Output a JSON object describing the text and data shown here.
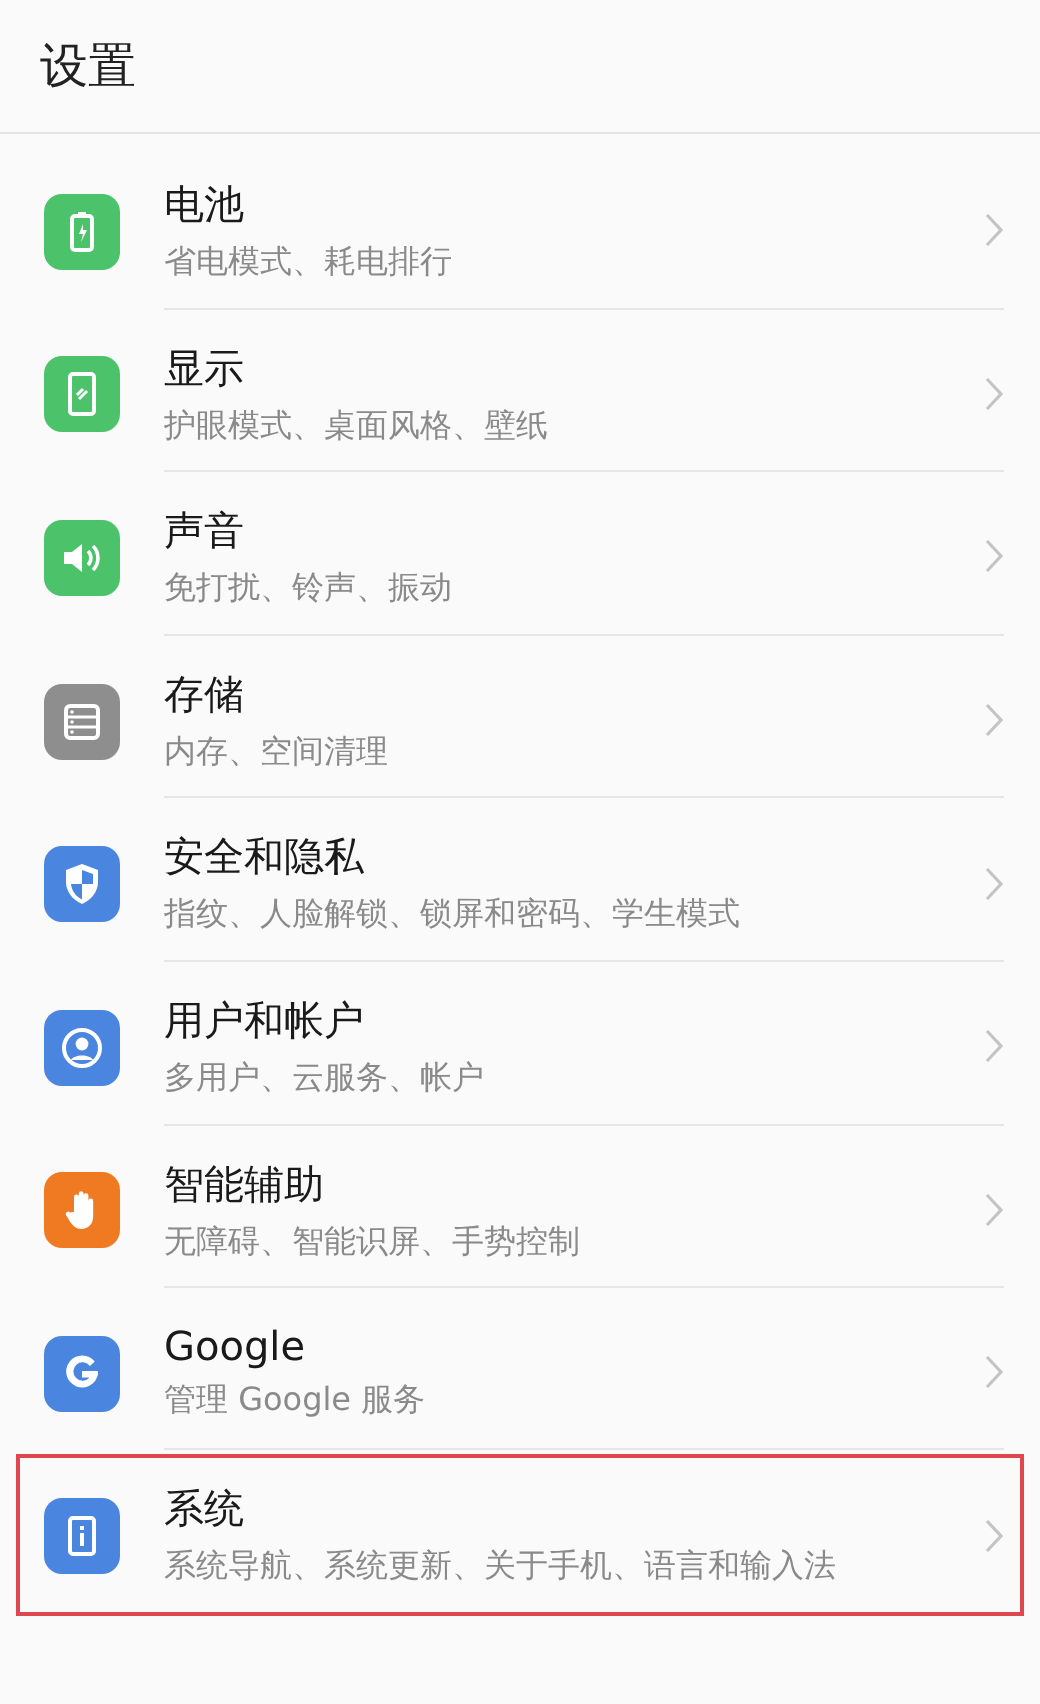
{
  "header": {
    "title": "设置"
  },
  "items": [
    {
      "kind": "battery",
      "title": "电池",
      "subtitle": "省电模式、耗电排行",
      "highlighted": false
    },
    {
      "kind": "display",
      "title": "显示",
      "subtitle": "护眼模式、桌面风格、壁纸",
      "highlighted": false
    },
    {
      "kind": "sound",
      "title": "声音",
      "subtitle": "免打扰、铃声、振动",
      "highlighted": false
    },
    {
      "kind": "storage",
      "title": "存储",
      "subtitle": "内存、空间清理",
      "highlighted": false
    },
    {
      "kind": "security",
      "title": "安全和隐私",
      "subtitle": "指纹、人脸解锁、锁屏和密码、学生模式",
      "highlighted": false
    },
    {
      "kind": "user",
      "title": "用户和帐户",
      "subtitle": "多用户、云服务、帐户",
      "highlighted": false
    },
    {
      "kind": "assist",
      "title": "智能辅助",
      "subtitle": "无障碍、智能识屏、手势控制",
      "highlighted": false
    },
    {
      "kind": "google",
      "title": "Google",
      "subtitle": "管理 Google 服务",
      "highlighted": false
    },
    {
      "kind": "system",
      "title": "系统",
      "subtitle": "系统导航、系统更新、关于手机、语言和输入法",
      "highlighted": true
    }
  ]
}
